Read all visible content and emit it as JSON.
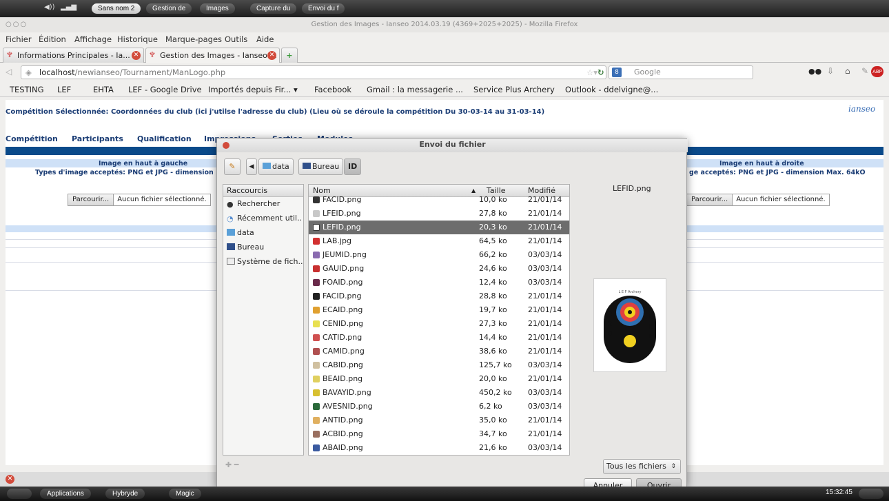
{
  "topbar": {
    "pills": [
      "Sans nom 2",
      "Gestion de",
      "Images",
      "Capture du",
      "Envoi du f"
    ]
  },
  "firefox": {
    "window_title": "Gestion des Images - Ianseo 2014.03.19 (4369+2025+2025) - Mozilla Firefox",
    "menus": [
      "Fichier",
      "Édition",
      "Affichage",
      "Historique",
      "Marque-pages",
      "Outils",
      "Aide"
    ],
    "tabs": [
      {
        "label": "Informations Principales - Ia..."
      },
      {
        "label": "Gestion des Images - Ianseo ..."
      }
    ],
    "url_host": "localhost",
    "url_path": "/newianseo/Tournament/ManLogo.php",
    "search_placeholder": "Google",
    "bookmarks": [
      "TESTING",
      "LEF",
      "EHTA",
      "LEF - Google Drive",
      "Importés depuis Fir... ▾",
      "Facebook",
      "Gmail : la messagerie ...",
      "Service Plus Archery",
      "Outlook - ddelvigne@..."
    ]
  },
  "page": {
    "competition_line": "Compétition Sélectionnée: Coordonnées du club (ici j'utilse l'adresse du club) (Lieu où se déroule la compétition Du 30-03-14 au 31-03-14)",
    "logo_text": "ianseo",
    "nav": [
      "Compétition",
      "Participants",
      "Qualification",
      "Impressions",
      "Sorties",
      "Modules"
    ],
    "left_header": "Image en haut à gauche",
    "left_types": "Types d'image acceptés: PNG et JPG - dimension Max",
    "right_header": "Image en haut à droite",
    "right_types": "ge acceptés: PNG et JPG - dimension Max. 64kO",
    "browse_label": "Parcourir...",
    "no_file": "Aucun fichier sélectionné.",
    "browse_label_right": "Parcourir...",
    "no_file_right": "Aucun fichier sélectionné."
  },
  "dialog": {
    "title": "Envoi du fichier",
    "path": [
      "data",
      "Bureau",
      "ID"
    ],
    "places_header": "Raccourcis",
    "places": [
      {
        "label": "Rechercher",
        "icon": "binoculars-icon"
      },
      {
        "label": "Récemment util...",
        "icon": "recent-icon"
      },
      {
        "label": "data",
        "icon": "folder-icon"
      },
      {
        "label": "Bureau",
        "icon": "desktop-icon"
      },
      {
        "label": "Système de fich...",
        "icon": "drive-icon"
      }
    ],
    "columns": {
      "name": "Nom",
      "size": "Taille",
      "modified": "Modifié"
    },
    "files": [
      {
        "name": "FACID.png",
        "size": "10,0 ko",
        "date": "21/01/14",
        "color": "#333333"
      },
      {
        "name": "LFEID.png",
        "size": "27,8 ko",
        "date": "21/01/14",
        "color": "#c8c8c8"
      },
      {
        "name": "LEFID.png",
        "size": "20,3 ko",
        "date": "21/01/14",
        "color": "#ffffff",
        "selected": true
      },
      {
        "name": "LAB.jpg",
        "size": "64,5 ko",
        "date": "21/01/14",
        "color": "#d23030"
      },
      {
        "name": "JEUMID.png",
        "size": "66,2 ko",
        "date": "03/03/14",
        "color": "#8a6bb0"
      },
      {
        "name": "GAUID.png",
        "size": "24,6 ko",
        "date": "03/03/14",
        "color": "#c83030"
      },
      {
        "name": "FOAID.png",
        "size": "12,4 ko",
        "date": "03/03/14",
        "color": "#6a2a4a"
      },
      {
        "name": "FACID.png",
        "size": "28,8 ko",
        "date": "21/01/14",
        "color": "#222222"
      },
      {
        "name": "ECAID.png",
        "size": "19,7 ko",
        "date": "21/01/14",
        "color": "#e0a030"
      },
      {
        "name": "CENID.png",
        "size": "27,3 ko",
        "date": "21/01/14",
        "color": "#e8e050"
      },
      {
        "name": "CATID.png",
        "size": "14,4 ko",
        "date": "21/01/14",
        "color": "#d05050"
      },
      {
        "name": "CAMID.png",
        "size": "38,6 ko",
        "date": "21/01/14",
        "color": "#b05050"
      },
      {
        "name": "CABID.png",
        "size": "125,7 ko",
        "date": "03/03/14",
        "color": "#d0c0a0"
      },
      {
        "name": "BEAID.png",
        "size": "20,0 ko",
        "date": "21/01/14",
        "color": "#e0d060"
      },
      {
        "name": "BAVAYID.png",
        "size": "450,2 ko",
        "date": "03/03/14",
        "color": "#d8c030"
      },
      {
        "name": "AVESNID.png",
        "size": "6,2 ko",
        "date": "03/03/14",
        "color": "#2a6a3a"
      },
      {
        "name": "ANTID.png",
        "size": "35,0 ko",
        "date": "21/01/14",
        "color": "#e0b060"
      },
      {
        "name": "ACBID.png",
        "size": "34,7 ko",
        "date": "21/01/14",
        "color": "#9a7060"
      },
      {
        "name": "ABAID.png",
        "size": "21,6 ko",
        "date": "03/03/14",
        "color": "#3a5aa0"
      }
    ],
    "preview_name": "LEFID.png",
    "preview_logo": {
      "top": "L E F Archery",
      "left_digits": [
        "3",
        "2",
        "0"
      ],
      "right_letters": [
        "L",
        "E",
        "F"
      ]
    },
    "filter": "Tous les fichiers",
    "cancel": "Annuler",
    "open": "Ouvrir"
  },
  "dock": {
    "items": [
      "Applications",
      "Hybryde",
      "Magic"
    ],
    "clock": "15:32:45"
  }
}
